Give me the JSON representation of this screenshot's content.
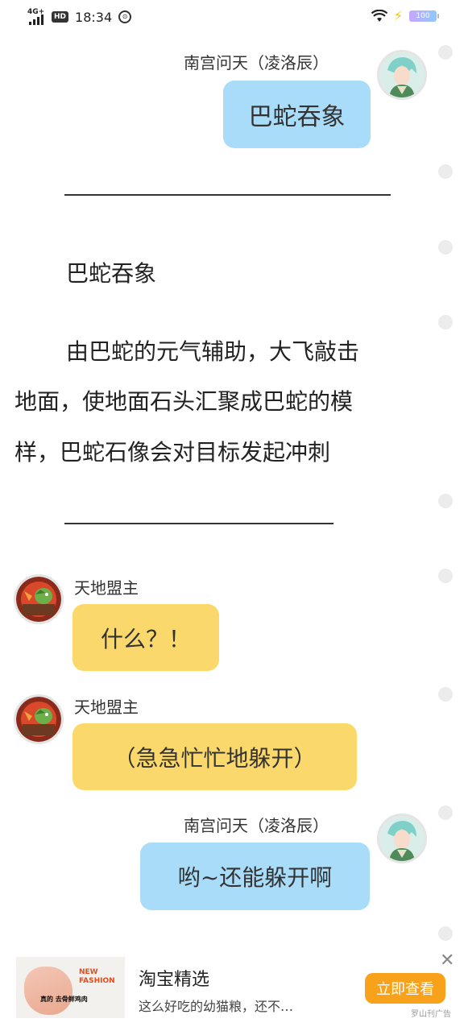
{
  "status_bar": {
    "network": "4G+",
    "hd": "HD",
    "time": "18:34",
    "battery": "100"
  },
  "messages": [
    {
      "sender": "南宫问天（凌洛辰）",
      "text": "巴蛇吞象"
    },
    {
      "sender": "天地盟主",
      "text": "什么？！"
    },
    {
      "sender": "天地盟主",
      "text": "（急急忙忙地躲开）"
    },
    {
      "sender": "南宫问天（凌洛辰）",
      "text": "哟~还能躲开啊"
    }
  ],
  "narration": {
    "divider_top": "——————————————",
    "skill_name": "巴蛇吞象",
    "description_lines": [
      "由巴蛇的元气辅助，大飞敲击",
      "地面，使地面石头汇聚成巴蛇的模",
      "样，巴蛇石像会对目标发起冲刺"
    ],
    "divider_bottom": "——————————————"
  },
  "ad": {
    "image_tag": "NEW FASHION",
    "image_caption": "真的 去骨鲜鸡肉",
    "title": "淘宝精选",
    "subtitle": "这么好吃的幼猫粮，还不…",
    "button": "立即查看",
    "close": "✕",
    "label": "罗山刊广告"
  }
}
